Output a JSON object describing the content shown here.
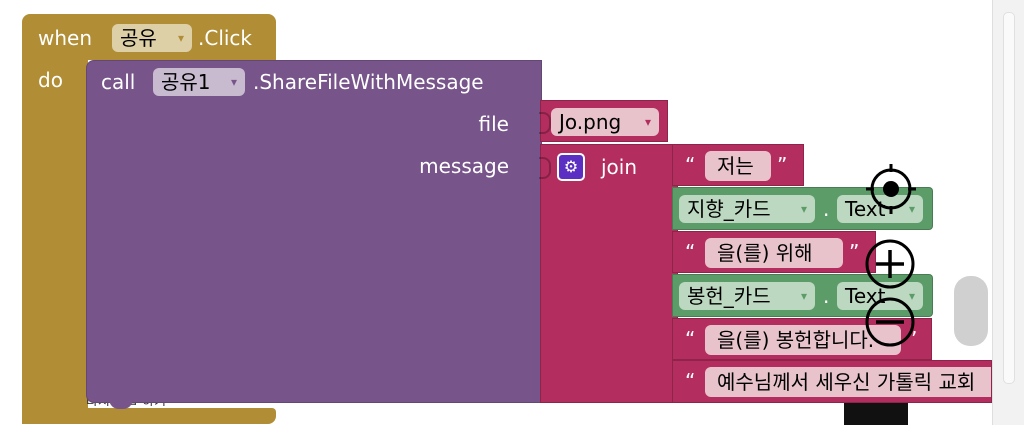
{
  "event_block": {
    "when": "when",
    "component": "공유",
    "event": ".Click",
    "do": "do",
    "color": "#b18e35"
  },
  "call_block": {
    "call": "call",
    "component": "공유1",
    "method": ".ShareFileWithMessage",
    "param_file": "file",
    "param_message": "message",
    "color": "#77548a"
  },
  "file_value": "Jo.png",
  "join_label": "join",
  "text_color": "#b32d5e",
  "component_color": "#5c9c68",
  "join_items": [
    {
      "type": "text",
      "value": "저는"
    },
    {
      "type": "getter",
      "component": "지향_카드",
      "dot": ".",
      "property": "Text"
    },
    {
      "type": "text",
      "value": "을(를) 위해"
    },
    {
      "type": "getter",
      "component": "봉헌_카드",
      "dot": ".",
      "property": "Text"
    },
    {
      "type": "text",
      "value": "을(를) 봉헌합니다."
    },
    {
      "type": "text",
      "value": "예수님께서 세우신 가톨릭 교회"
    }
  ],
  "hidden_text": "다시 제출 하기",
  "quote_open": "“",
  "quote_close": "”",
  "dropdown_arrow": "▾",
  "workspace_controls": [
    "target-icon",
    "zoom-in-icon",
    "zoom-out-icon"
  ]
}
